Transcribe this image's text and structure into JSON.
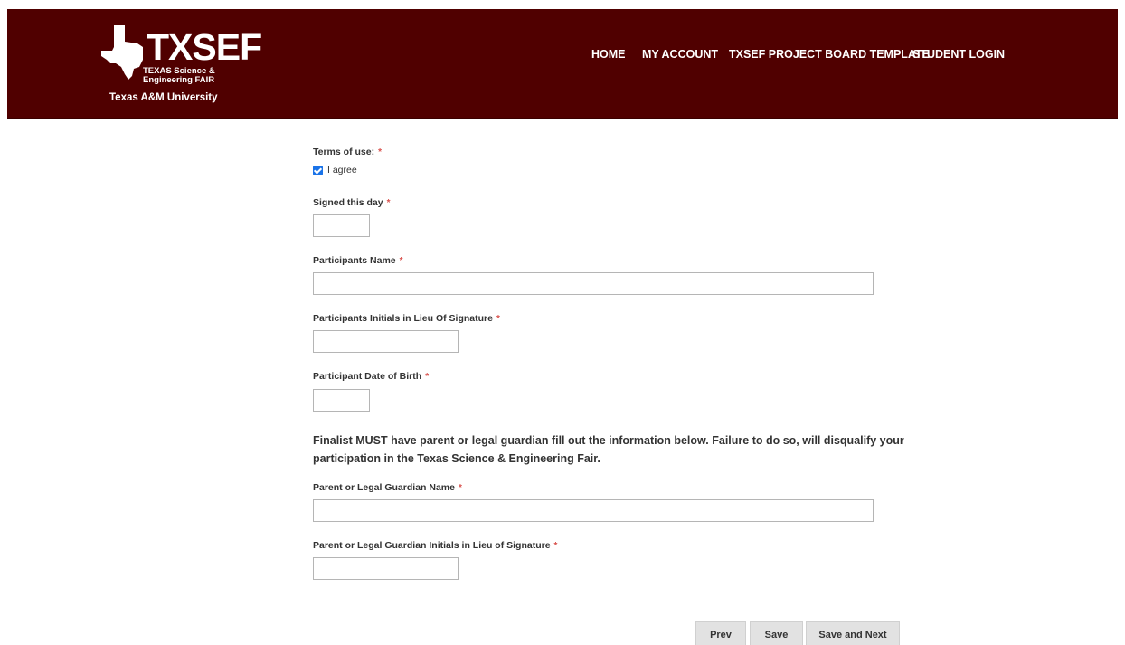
{
  "header": {
    "logo_main": "TXSEF",
    "logo_sub1": "TEXAS Science &",
    "logo_sub2": "Engineering FAIR",
    "university": "Texas A&M University",
    "bg_color": "#500000"
  },
  "nav": {
    "home": "HOME",
    "account": "MY ACCOUNT",
    "template": "TXSEF PROJECT BOARD TEMPLATE",
    "login": "STUDENT LOGIN"
  },
  "form": {
    "terms_label": "Terms of use:",
    "agree_label": "I agree",
    "agree_checked": true,
    "signed_label": "Signed this day",
    "signed_value": "",
    "participant_name_label": "Participants Name",
    "participant_name_value": "",
    "participant_initials_label": "Participants Initials in Lieu Of Signature",
    "participant_initials_value": "",
    "dob_label": "Participant Date of Birth",
    "dob_value": "",
    "notice": "Finalist MUST have parent or legal guardian fill out the information below. Failure to do so, will disqualify your participation in the Texas Science & Engineering Fair.",
    "guardian_name_label": "Parent or Legal Guardian Name",
    "guardian_name_value": "",
    "guardian_initials_label": "Parent or Legal Guardian Initials in Lieu of Signature",
    "guardian_initials_value": "",
    "required_mark": "*"
  },
  "buttons": {
    "prev": "Prev",
    "save": "Save",
    "save_next": "Save and Next"
  }
}
